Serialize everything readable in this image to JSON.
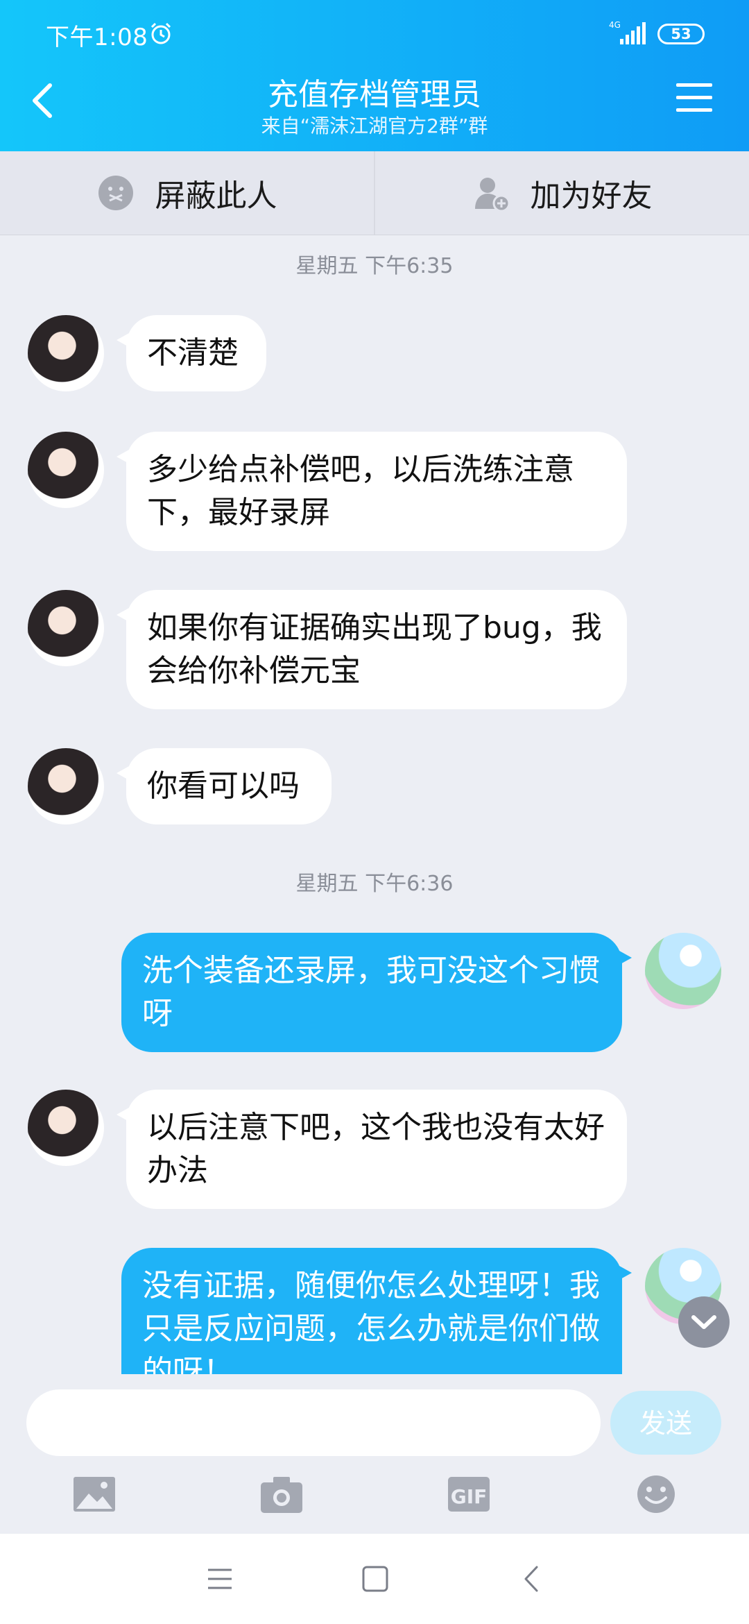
{
  "status": {
    "time": "下午1:08",
    "network": "4G",
    "battery": "53"
  },
  "header": {
    "title": "充值存档管理员",
    "subtitle": "来自“濡沫江湖官方2群”群"
  },
  "actions": {
    "block_label": "屏蔽此人",
    "add_friend_label": "加为好友"
  },
  "messages": [
    {
      "type": "time",
      "text": "星期五 下午6:35"
    },
    {
      "type": "in",
      "text": "不清楚"
    },
    {
      "type": "in",
      "text": "多少给点补偿吧，以后洗练注意下，最好录屏"
    },
    {
      "type": "in",
      "text": "如果你有证据确实出现了bug，我会给你补偿元宝"
    },
    {
      "type": "in",
      "text": "你看可以吗"
    },
    {
      "type": "time",
      "text": "星期五 下午6:36"
    },
    {
      "type": "out",
      "text": "洗个装备还录屏，我可没这个习惯呀"
    },
    {
      "type": "in",
      "text": "以后注意下吧，这个我也没有太好办法"
    },
    {
      "type": "out",
      "text": "没有证据，随便你怎么处理呀！我只是反应问题，怎么办就是你们做的呀！"
    }
  ],
  "composer": {
    "input_value": "",
    "send_label": "发送"
  },
  "toolbar": {
    "icons": [
      "image-icon",
      "camera-icon",
      "gif-icon",
      "emoji-icon"
    ],
    "gif_label": "GIF"
  },
  "colors": {
    "header_start": "#14c6fa",
    "header_end": "#0f9cf6",
    "outgoing_bubble": "#1fb3f7",
    "incoming_bubble": "#ffffff",
    "send_button_disabled": "#c6ecfb"
  }
}
